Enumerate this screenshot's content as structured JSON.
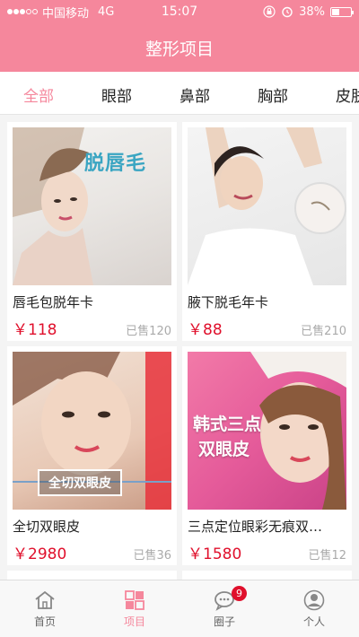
{
  "status": {
    "carrier": "中国移动",
    "network": "4G",
    "time": "15:07",
    "battery": "38%",
    "battery_level": 0.38
  },
  "header": {
    "title": "整形项目"
  },
  "tabs": [
    {
      "label": "全部",
      "active": true
    },
    {
      "label": "眼部",
      "active": false
    },
    {
      "label": "鼻部",
      "active": false
    },
    {
      "label": "胸部",
      "active": false
    },
    {
      "label": "皮肤",
      "active": false
    }
  ],
  "products": [
    {
      "title": "唇毛包脱年卡",
      "price": "￥118",
      "sold": "已售120",
      "image_text": "脱唇毛"
    },
    {
      "title": "腋下脱毛年卡",
      "price": "￥88",
      "sold": "已售210",
      "image_text": ""
    },
    {
      "title": "全切双眼皮",
      "price": "￥2980",
      "sold": "已售36",
      "image_text": "全切双眼皮"
    },
    {
      "title": "三点定位眼彩无痕双…",
      "price": "￥1580",
      "sold": "已售12",
      "image_text_line1": "韩式三点",
      "image_text_line2": "双眼皮"
    }
  ],
  "tabbar": [
    {
      "label": "首页",
      "icon": "home-icon",
      "active": false
    },
    {
      "label": "项目",
      "icon": "grid-icon",
      "active": true
    },
    {
      "label": "圈子",
      "icon": "chat-icon",
      "active": false,
      "badge": "9"
    },
    {
      "label": "个人",
      "icon": "person-icon",
      "active": false
    }
  ],
  "colors": {
    "brand": "#f5879c",
    "price": "#e0102c"
  }
}
